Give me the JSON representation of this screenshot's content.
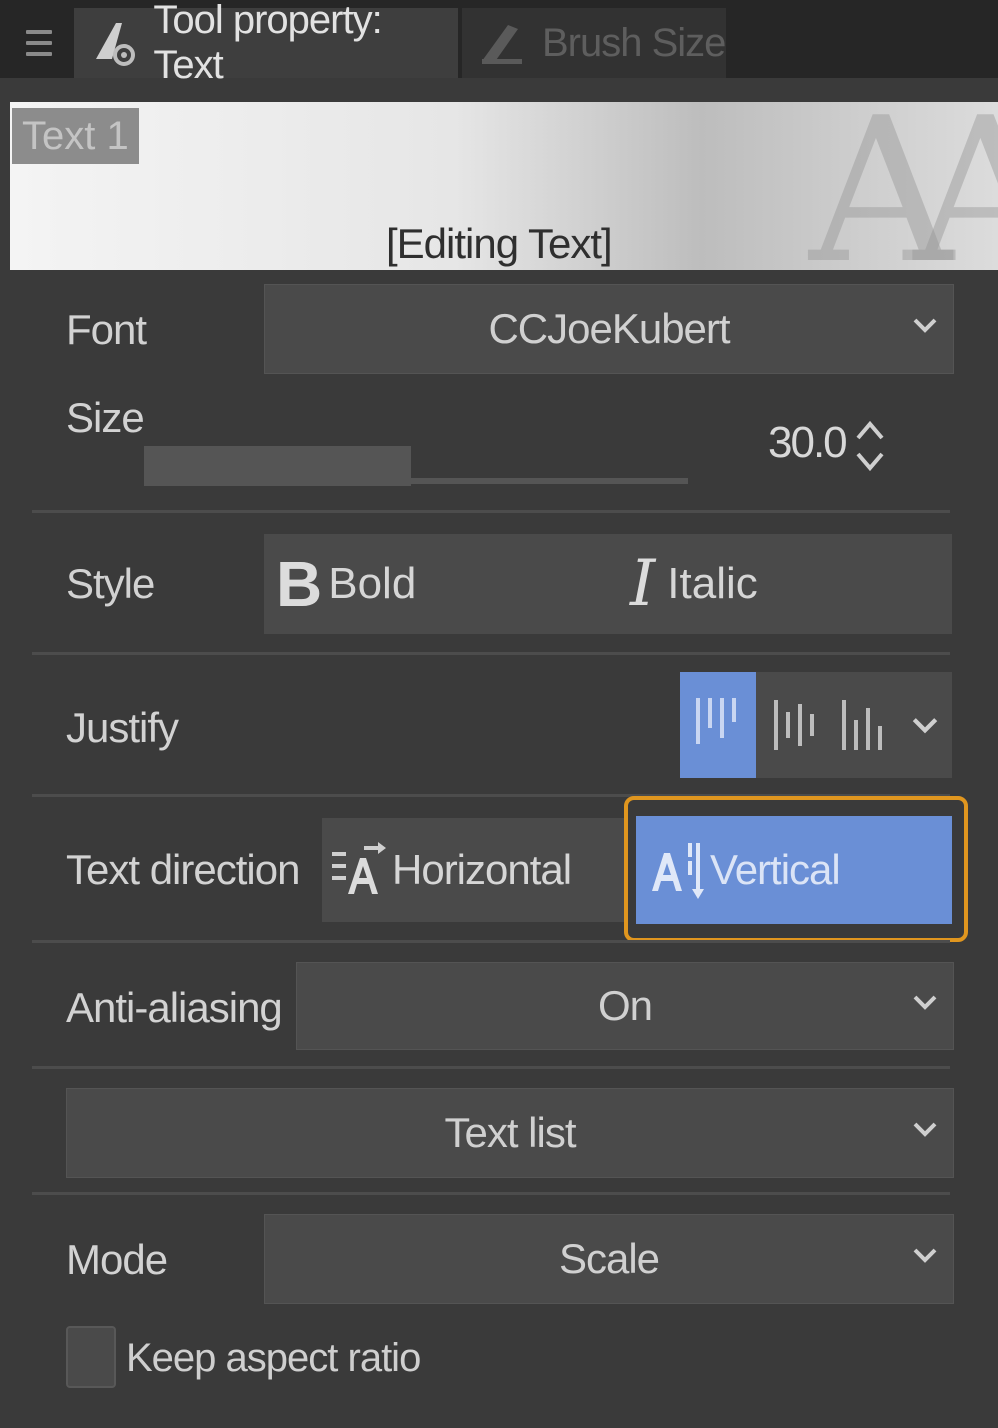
{
  "tabs": [
    {
      "label": "Tool property: Text",
      "active": true,
      "icon": "text-tool-icon"
    },
    {
      "label": "Brush Size",
      "active": false,
      "icon": "brush-size-icon"
    }
  ],
  "preview": {
    "sample_label": "Text 1",
    "status": "[Editing Text]",
    "watermark": "AA"
  },
  "font": {
    "label": "Font",
    "value": "CCJoeKubert"
  },
  "size": {
    "label": "Size",
    "value": "30.0",
    "slider_fraction": 0.49
  },
  "style": {
    "label": "Style",
    "bold": "Bold",
    "italic": "Italic"
  },
  "justify": {
    "label": "Justify",
    "selected": "top-align",
    "options": [
      "top-align-icon",
      "center-align-icon",
      "bottom-align-icon"
    ]
  },
  "text_direction": {
    "label": "Text direction",
    "horizontal": "Horizontal",
    "vertical": "Vertical",
    "selected": "Vertical"
  },
  "anti_aliasing": {
    "label": "Anti-aliasing",
    "value": "On"
  },
  "text_list": {
    "label": "Text list"
  },
  "mode": {
    "label": "Mode",
    "value": "Scale"
  },
  "keep_aspect": {
    "label": "Keep aspect ratio",
    "checked": false
  },
  "colors": {
    "accent": "#6a8fd6",
    "highlight": "#e0961f",
    "panel": "#3a3a3a"
  }
}
